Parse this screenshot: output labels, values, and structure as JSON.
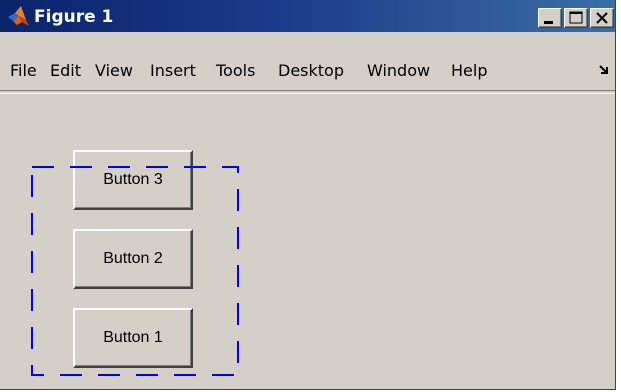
{
  "window": {
    "title": "Figure 1",
    "icon": "matlab-logo-icon",
    "controls": [
      "minimize-icon",
      "maximize-icon",
      "close-icon"
    ]
  },
  "menubar": {
    "items": [
      "File",
      "Edit",
      "View",
      "Insert",
      "Tools",
      "Desktop",
      "Window",
      "Help"
    ],
    "dock_icon": "dock-arrow-icon"
  },
  "figure": {
    "background": "#d4d0c8",
    "buttons": [
      {
        "label": "Button 3"
      },
      {
        "label": "Button 2"
      },
      {
        "label": "Button 1"
      }
    ],
    "panel_border_color": "#0000ff"
  }
}
